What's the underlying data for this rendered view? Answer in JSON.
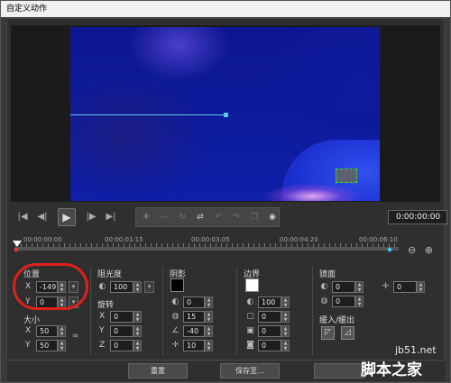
{
  "window": {
    "title": "自定义动作"
  },
  "timecode": "0:00:00:00",
  "timeline": {
    "ticks": [
      "00:00:00:00",
      "00:00:01:15",
      "00:00:03:05",
      "00:00:04:20",
      "00:00:06:10"
    ]
  },
  "position": {
    "title": "位置",
    "x_label": "X",
    "x_value": "-149",
    "y_label": "Y",
    "y_value": "0"
  },
  "size": {
    "title": "大小",
    "x_label": "X",
    "x_value": "50",
    "y_label": "Y",
    "y_value": "50"
  },
  "opacity": {
    "title": "阻光度",
    "value": "100"
  },
  "rotation": {
    "title": "旋转",
    "x_label": "X",
    "x_value": "0",
    "y_label": "Y",
    "y_value": "0",
    "z_label": "Z",
    "z_value": "0"
  },
  "shadow": {
    "title": "阴影",
    "color": "#000000",
    "opacity": "0",
    "blur": "15",
    "angle": "-40",
    "distance": "10"
  },
  "border": {
    "title": "边界",
    "color": "#ffffff",
    "opacity": "100",
    "width": "0",
    "soft1": "0",
    "soft2": "0"
  },
  "mirror": {
    "title": "镜面",
    "opacity": "0",
    "distance": "0",
    "offset": "0"
  },
  "ease": {
    "title": "缓入/缓出"
  },
  "buttons": {
    "reset": "重置",
    "save": "保存至..."
  },
  "watermark": {
    "site": "jb51.net",
    "text": "脚本之家"
  }
}
